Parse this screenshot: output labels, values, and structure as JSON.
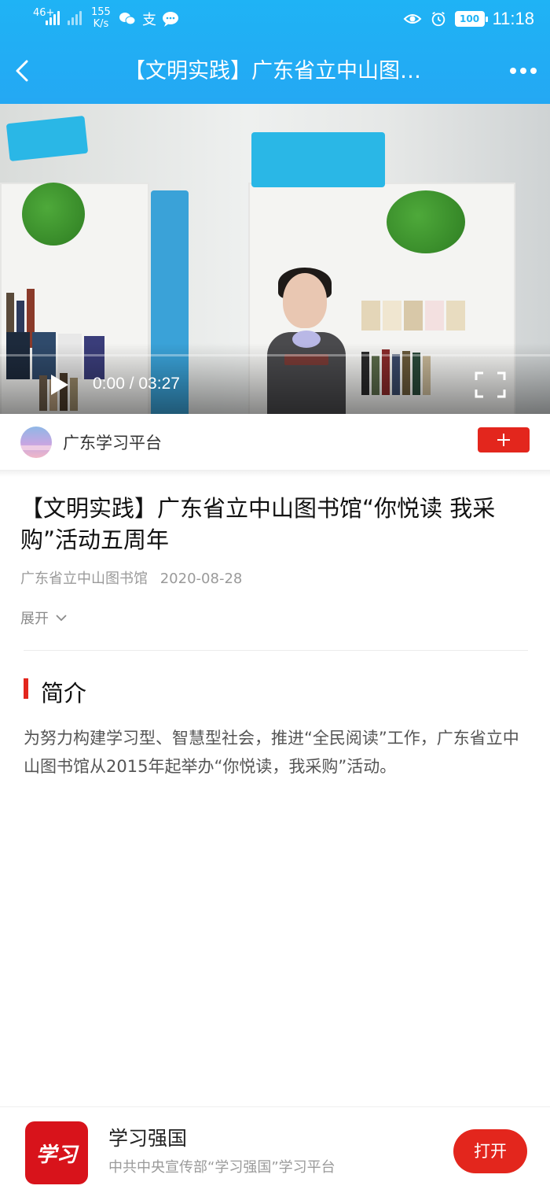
{
  "status_bar": {
    "network": "46+",
    "speed_value": "155",
    "speed_unit": "K/s",
    "battery": "100",
    "time": "11:18"
  },
  "nav": {
    "title": "【文明实践】广东省立中山图…"
  },
  "video": {
    "time_display": "0:00 / 03:27",
    "progress": 0.0
  },
  "channel": {
    "name": "广东学习平台"
  },
  "article": {
    "title": "【文明实践】广东省立中山图书馆“你悦读 我采购”活动五周年",
    "source": "广东省立中山图书馆",
    "date": "2020-08-28",
    "expand_label": "展开"
  },
  "section": {
    "title": "简介",
    "body": "为努力构建学习型、智慧型社会，推进“全民阅读”工作，广东省立中山图书馆从2015年起举办“你悦读，我采购”活动。"
  },
  "app_banner": {
    "logo_text": "学习",
    "name": "学习强国",
    "desc": "中共中央宣传部“学习强国”学习平台",
    "open_label": "打开"
  },
  "colors": {
    "header": "#1fb3f5",
    "accent_red": "#e3261d"
  },
  "icons": [
    "back-arrow-icon",
    "more-icon",
    "play-icon",
    "fullscreen-icon",
    "follow-plus-icon",
    "chevron-down-icon",
    "eye-icon",
    "alarm-icon",
    "wechat-icon",
    "alipay-icon",
    "message-icon"
  ]
}
